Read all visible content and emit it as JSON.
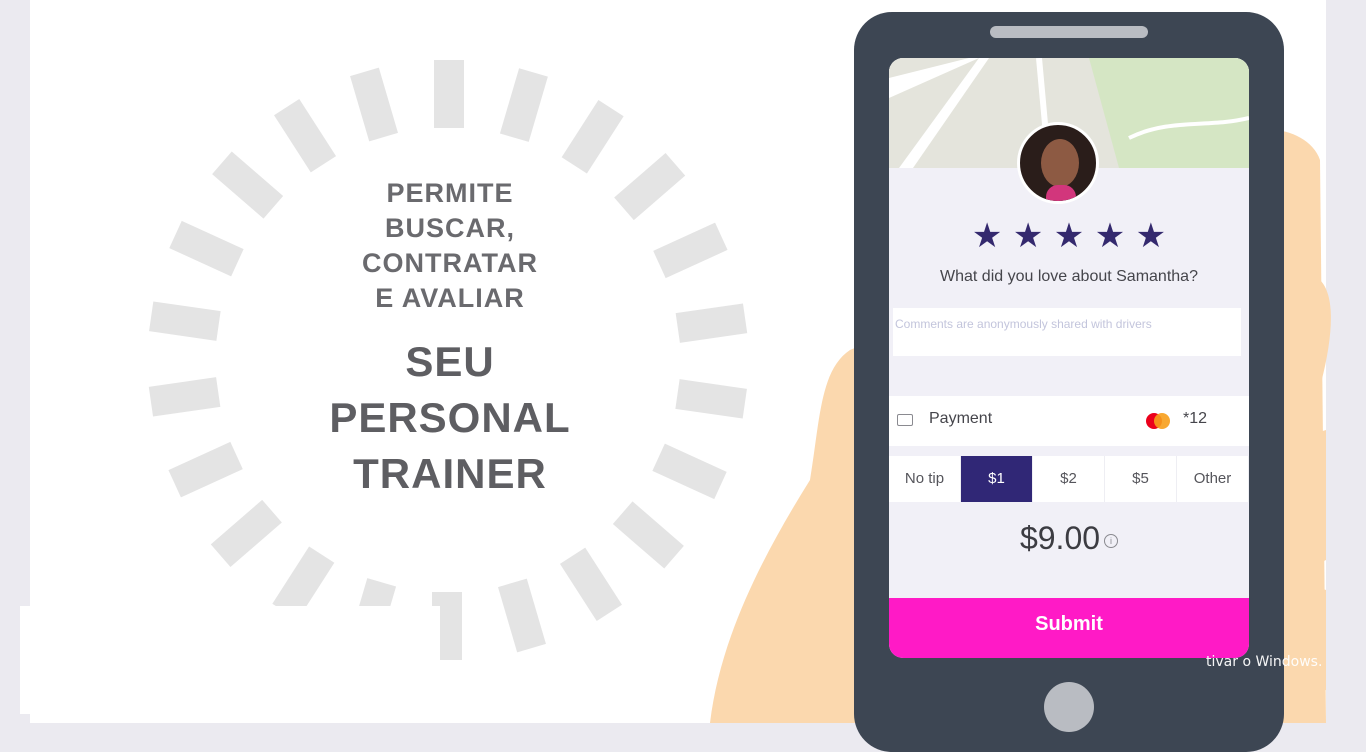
{
  "headline": {
    "lines": [
      "PERMITE",
      "BUSCAR,",
      "CONTRATAR",
      "E AVALIAR"
    ],
    "big_lines": [
      "SEU",
      "PERSONAL",
      "TRAINER"
    ]
  },
  "phone_app": {
    "rating": {
      "stars": 5,
      "max": 5
    },
    "question": "What did you love about Samantha?",
    "comments_placeholder": "Comments are anonymously shared with drivers",
    "payment": {
      "label": "Payment",
      "card_digits": "*12"
    },
    "tips": [
      {
        "label": "No tip",
        "selected": false
      },
      {
        "label": "$1",
        "selected": true
      },
      {
        "label": "$2",
        "selected": false
      },
      {
        "label": "$5",
        "selected": false
      },
      {
        "label": "Other",
        "selected": false
      }
    ],
    "total": "$9.00",
    "submit_label": "Submit",
    "colors": {
      "accent": "#302776",
      "submit": "#ff1ac6",
      "star": "#34296e"
    }
  },
  "watermark_text": "tivar o Windows."
}
